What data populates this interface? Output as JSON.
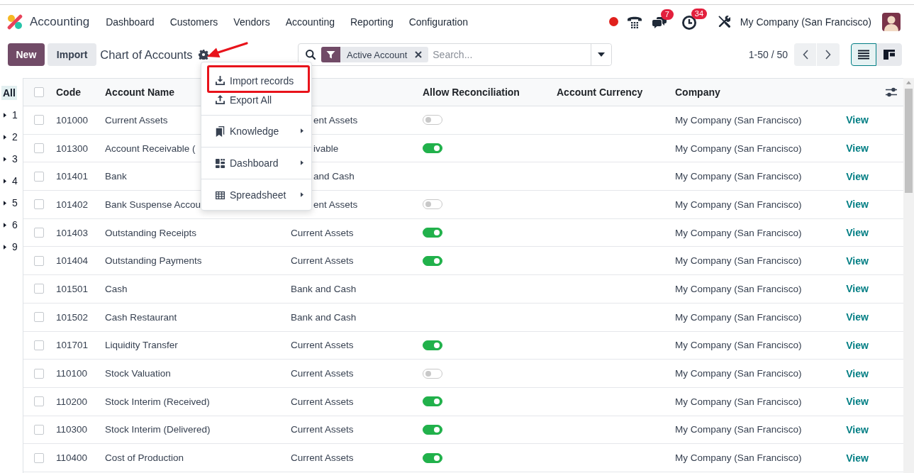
{
  "navbar": {
    "app_name": "Accounting",
    "menu": [
      "Dashboard",
      "Customers",
      "Vendors",
      "Accounting",
      "Reporting",
      "Configuration"
    ],
    "messages_badge": "7",
    "activities_badge": "34",
    "company": "My Company (San Francisco)"
  },
  "control_panel": {
    "buttons": [
      {
        "label": "New",
        "kind": "primary"
      },
      {
        "label": "Import",
        "kind": "secondary"
      }
    ],
    "title": "Chart of Accounts",
    "search": {
      "facets": [
        "Active Account"
      ],
      "placeholder": "Search..."
    },
    "pager": "1-50 / 50",
    "views": [
      {
        "kind": "list",
        "selected": true
      },
      {
        "kind": "kanban",
        "selected": false
      }
    ]
  },
  "gear_menu": {
    "groups": [
      [
        {
          "label": "Import records",
          "kind": "action",
          "highlighted": true
        },
        {
          "label": "Export All",
          "kind": "action",
          "highlighted": false
        }
      ],
      [
        {
          "label": "Knowledge",
          "kind": "submenu",
          "highlighted": false
        }
      ],
      [
        {
          "label": "Dashboard",
          "kind": "submenu",
          "highlighted": false
        }
      ],
      [
        {
          "label": "Spreadsheet",
          "kind": "submenu",
          "highlighted": false
        }
      ]
    ]
  },
  "annotations": [
    {
      "kind": "arrow"
    }
  ],
  "sidebar": {
    "items": [
      {
        "label": "All",
        "selected": true,
        "expandable": false
      },
      {
        "label": "1",
        "selected": false,
        "expandable": true
      },
      {
        "label": "2",
        "selected": false,
        "expandable": true
      },
      {
        "label": "3",
        "selected": false,
        "expandable": true
      },
      {
        "label": "4",
        "selected": false,
        "expandable": true
      },
      {
        "label": "5",
        "selected": false,
        "expandable": true
      },
      {
        "label": "6",
        "selected": false,
        "expandable": true
      },
      {
        "label": "9",
        "selected": false,
        "expandable": true
      }
    ]
  },
  "table": {
    "select_all": false,
    "columns": [
      "Code",
      "Account Name",
      "Allow Reconciliation",
      "Account Currency",
      "Company"
    ],
    "rows": [
      {
        "selected": false,
        "code": "101000",
        "name": "Current Assets",
        "column_3": "ent Assets",
        "reconcile": false,
        "company": "My Company (San Francisco)",
        "column_7": "View"
      },
      {
        "selected": false,
        "code": "101300",
        "name": "Account Receivable (",
        "column_3": "ivable",
        "reconcile": true,
        "company": "My Company (San Francisco)",
        "column_7": "View"
      },
      {
        "selected": false,
        "code": "101401",
        "name": "Bank",
        "column_3": "and Cash",
        "company": "My Company (San Francisco)",
        "column_7": "View"
      },
      {
        "selected": false,
        "code": "101402",
        "name": "Bank Suspense Accou",
        "column_3": "ent Assets",
        "reconcile": false,
        "company": "My Company (San Francisco)",
        "column_7": "View"
      },
      {
        "selected": false,
        "code": "101403",
        "name": "Outstanding Receipts",
        "column_3": "Current Assets",
        "reconcile": true,
        "company": "My Company (San Francisco)",
        "column_7": "View"
      },
      {
        "selected": false,
        "code": "101404",
        "name": "Outstanding Payments",
        "column_3": "Current Assets",
        "reconcile": true,
        "company": "My Company (San Francisco)",
        "column_7": "View"
      },
      {
        "selected": false,
        "code": "101501",
        "name": "Cash",
        "column_3": "Bank and Cash",
        "company": "My Company (San Francisco)",
        "column_7": "View"
      },
      {
        "selected": false,
        "code": "101502",
        "name": "Cash Restaurant",
        "column_3": "Bank and Cash",
        "company": "My Company (San Francisco)",
        "column_7": "View"
      },
      {
        "selected": false,
        "code": "101701",
        "name": "Liquidity Transfer",
        "column_3": "Current Assets",
        "reconcile": true,
        "company": "My Company (San Francisco)",
        "column_7": "View"
      },
      {
        "selected": false,
        "code": "110100",
        "name": "Stock Valuation",
        "column_3": "Current Assets",
        "reconcile": false,
        "company": "My Company (San Francisco)",
        "column_7": "View"
      },
      {
        "selected": false,
        "code": "110200",
        "name": "Stock Interim (Received)",
        "column_3": "Current Assets",
        "reconcile": true,
        "company": "My Company (San Francisco)",
        "column_7": "View"
      },
      {
        "selected": false,
        "code": "110300",
        "name": "Stock Interim (Delivered)",
        "column_3": "Current Assets",
        "reconcile": true,
        "company": "My Company (San Francisco)",
        "column_7": "View"
      },
      {
        "selected": false,
        "code": "110400",
        "name": "Cost of Production",
        "column_3": "Current Assets",
        "reconcile": true,
        "company": "My Company (San Francisco)",
        "column_7": "View"
      }
    ]
  }
}
